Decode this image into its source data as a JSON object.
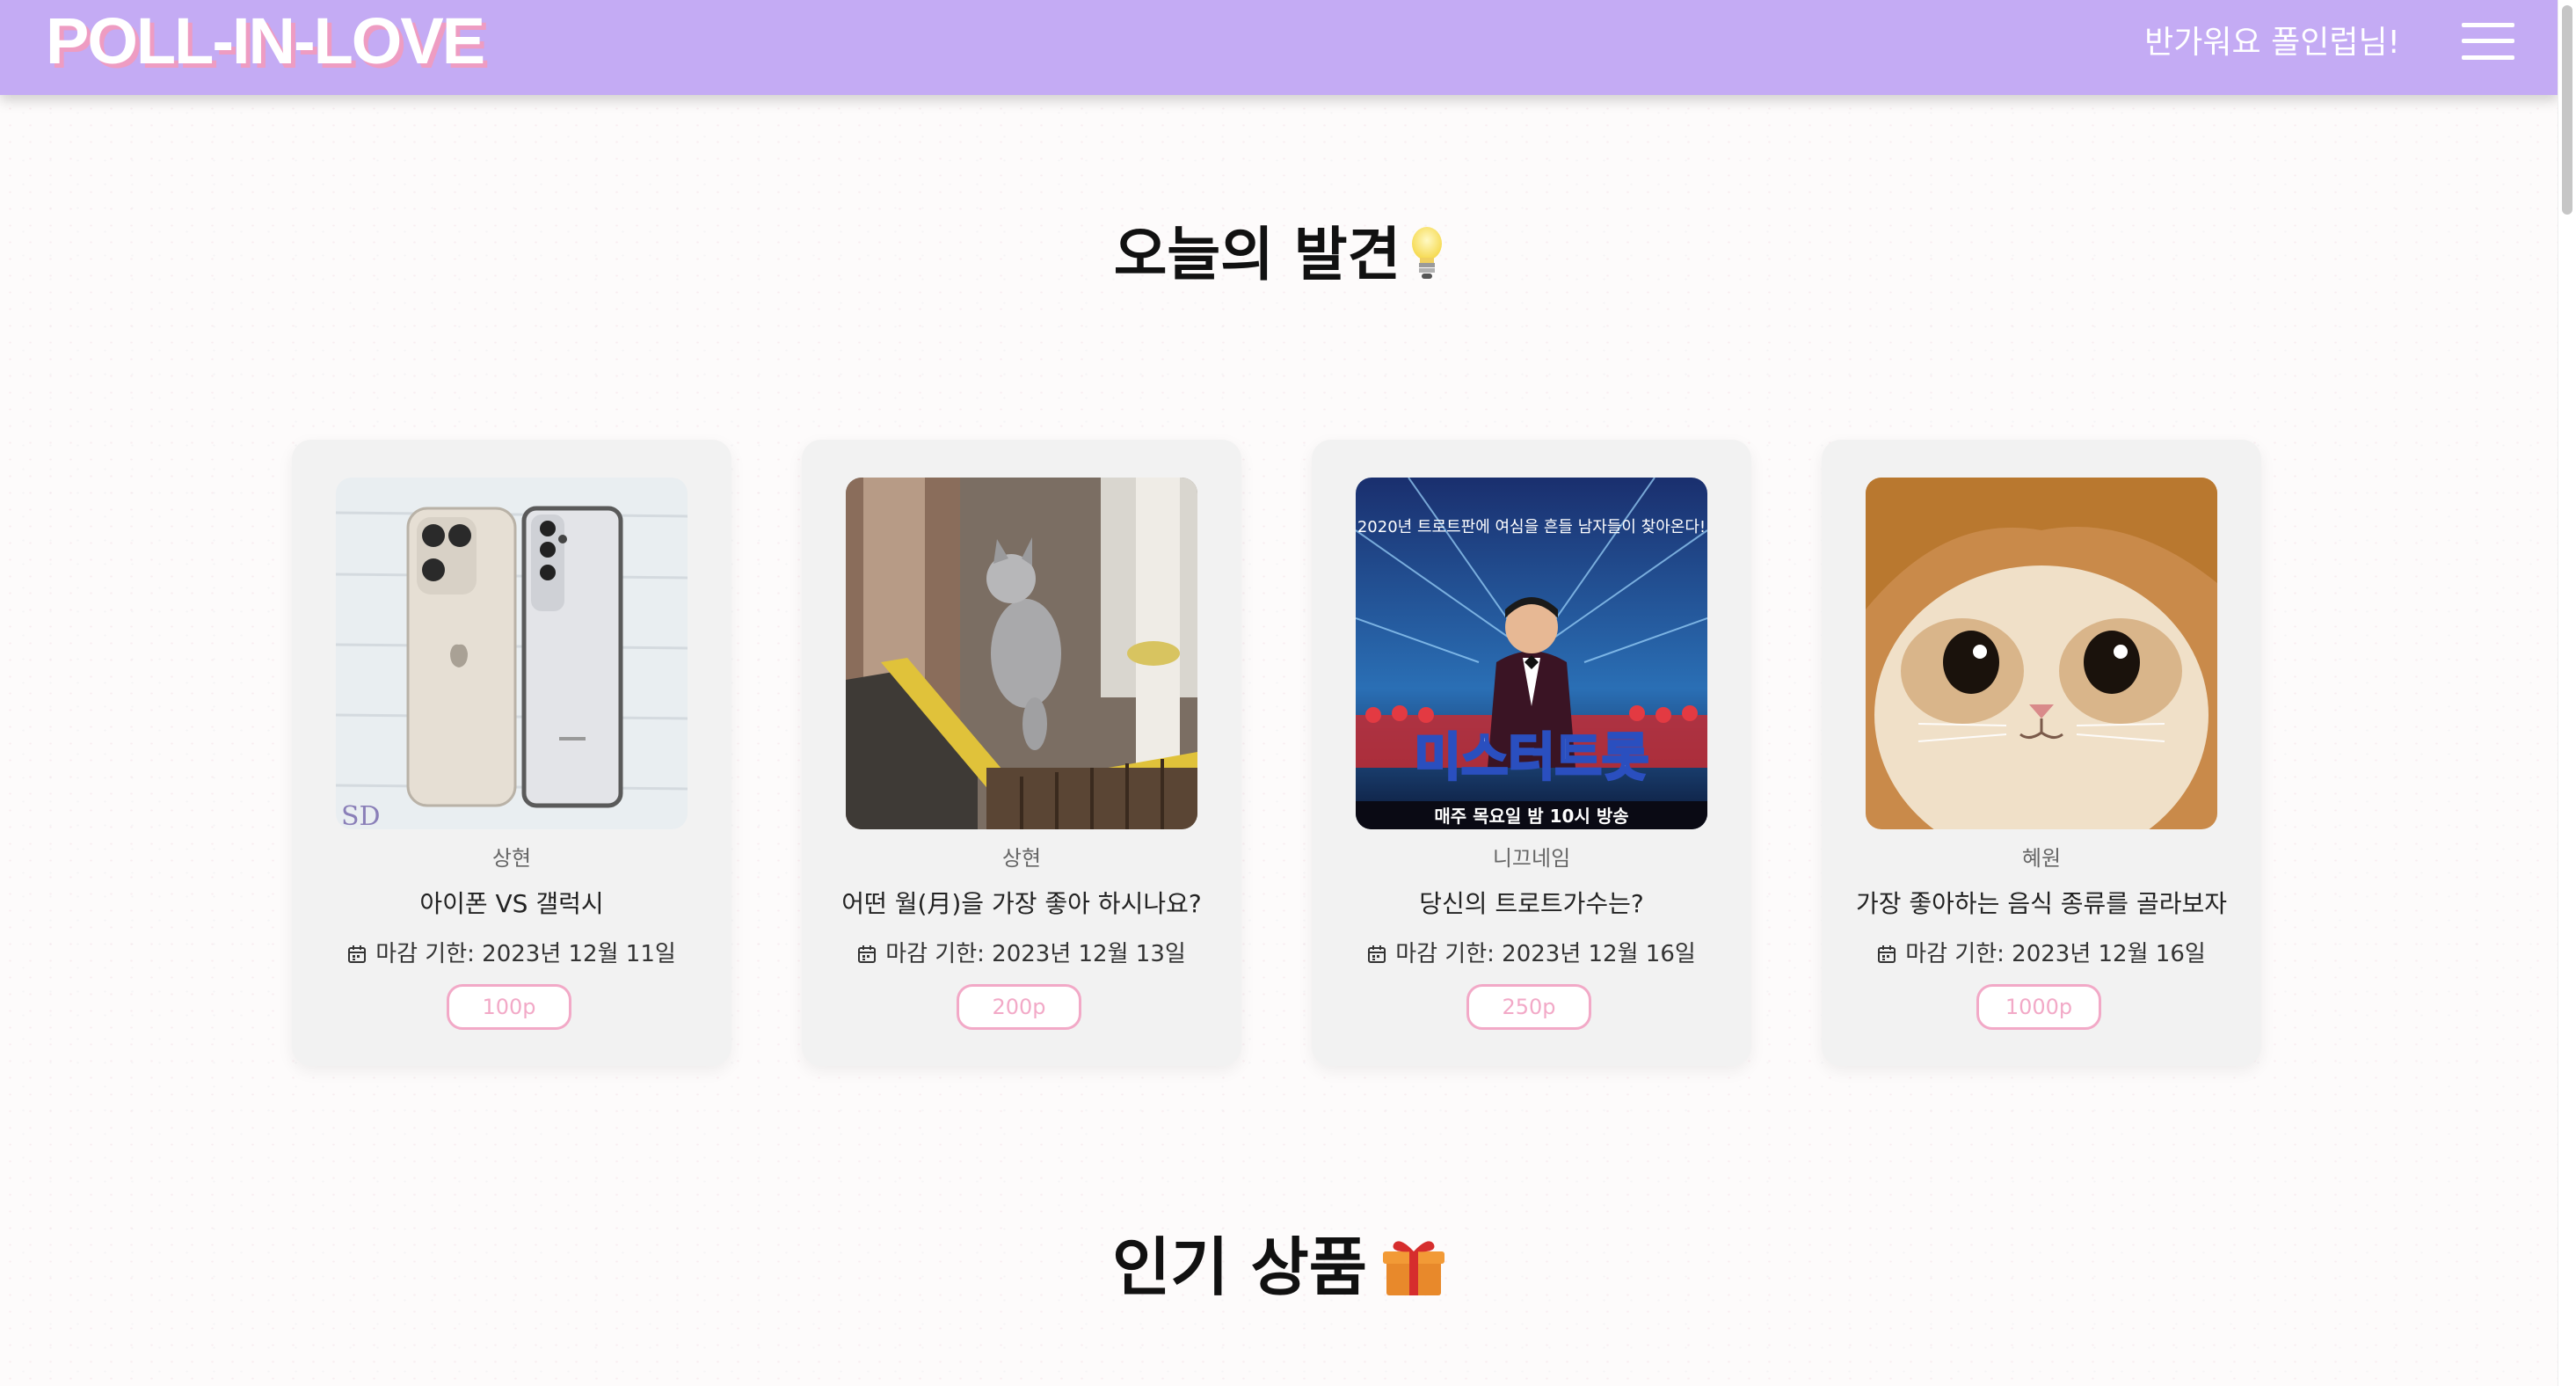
{
  "header": {
    "logo": "POLL-IN-LOVE",
    "greeting": "반가워요 폴인럽님!"
  },
  "sections": {
    "discover_title": "오늘의 발견",
    "discover_icon": "lightbulb-icon",
    "popular_title": "인기 상품",
    "popular_icon": "gift-icon"
  },
  "cards": [
    {
      "image": "phones-image",
      "author": "상현",
      "title": "아이폰 VS 갤럭시",
      "deadline": "마감 기한: 2023년 12월 11일",
      "points": "100p"
    },
    {
      "image": "cat-door-image",
      "author": "상현",
      "title": "어떤 월(月)을 가장 좋아 하시나요?",
      "deadline": "마감 기한: 2023년 12월 13일",
      "points": "200p"
    },
    {
      "image": "trot-show-image",
      "author": "니끄네임",
      "title": "당신의 트로트가수는?",
      "deadline": "마감 기한: 2023년 12월 16일",
      "points": "250p"
    },
    {
      "image": "cat-hood-image",
      "author": "혜원",
      "title": "가장 좋아하는 음식 종류를 골라보자",
      "deadline": "마감 기한: 2023년 12월 16일",
      "points": "1000p"
    }
  ],
  "poster_text": {
    "headline": "2020년 트로트판에 여심을 흔들 남자들이 찾아온다!",
    "show_title": "미스터트롯",
    "schedule": "매주 목요일 밤 10시 방송"
  },
  "colors": {
    "header_bg": "#c4abf4",
    "logo_shadow": "#ee9cc2",
    "points_accent": "#f2a9c7"
  }
}
